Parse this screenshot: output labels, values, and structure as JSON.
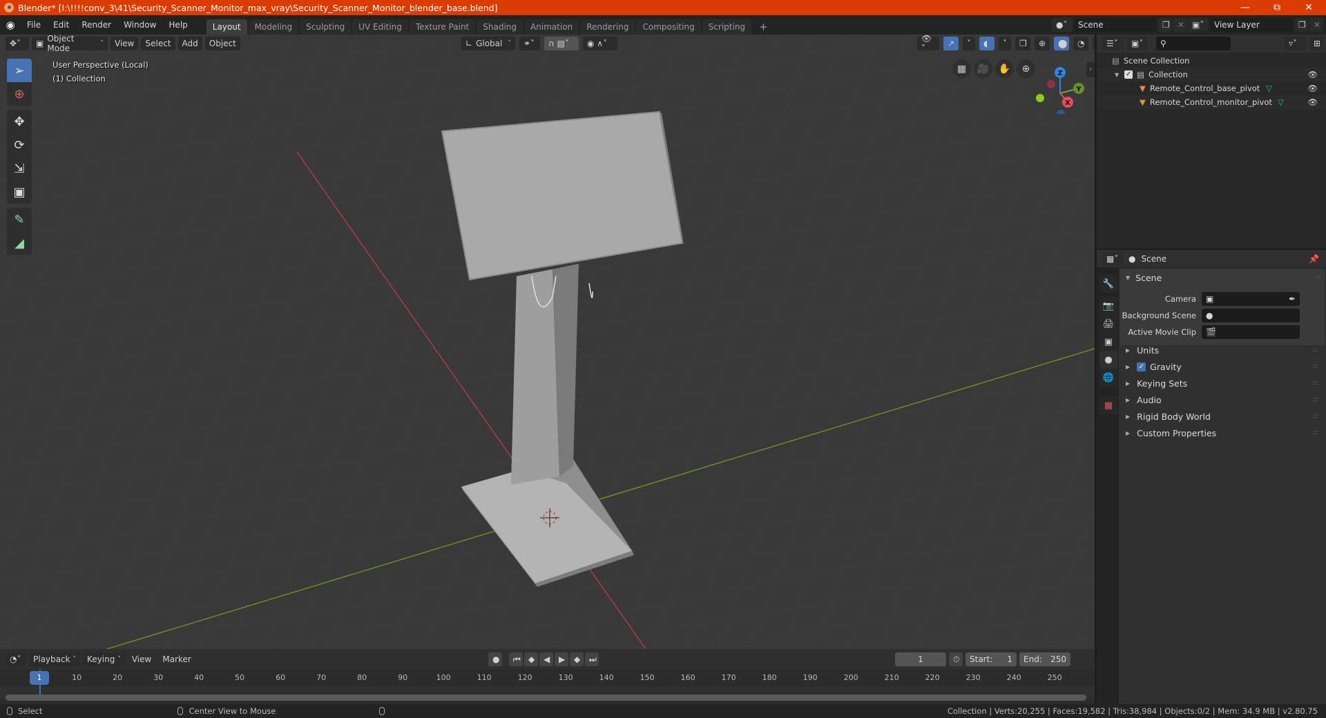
{
  "window": {
    "title": "Blender* [I:\\!!!!conv_3\\41\\Security_Scanner_Monitor_max_vray\\Security_Scanner_Monitor_blender_base.blend]",
    "controls": [
      "minimize-icon",
      "maximize-icon",
      "close-icon"
    ]
  },
  "menubar": {
    "items": [
      "File",
      "Edit",
      "Render",
      "Window",
      "Help"
    ],
    "workspace_tabs": [
      "Layout",
      "Modeling",
      "Sculpting",
      "UV Editing",
      "Texture Paint",
      "Shading",
      "Animation",
      "Rendering",
      "Compositing",
      "Scripting"
    ],
    "active_tab": "Layout",
    "add_tab": "+",
    "scene_field": "Scene",
    "view_layer_field": "View Layer"
  },
  "viewport": {
    "mode": "Object Mode",
    "menus": [
      "View",
      "Select",
      "Add",
      "Object"
    ],
    "transform_orientation": "Global",
    "overlay_text": [
      "User Perspective (Local)",
      "(1) Collection"
    ],
    "tools": [
      "select-box-icon",
      "cursor-icon",
      "move-icon",
      "rotate-icon",
      "scale-icon",
      "transform-icon",
      "annotate-icon",
      "measure-icon"
    ],
    "nav_buttons": [
      "grid-view-icon",
      "camera-view-icon",
      "pan-hand-icon",
      "zoom-icon"
    ],
    "gizmo_axes": [
      "Z",
      "Y",
      "X"
    ],
    "colors": {
      "x_axis": "#c8394c",
      "y_axis": "#7aa22f",
      "z_axis": "#2f86e3",
      "background": "#393939",
      "model": "#a8a8a8"
    }
  },
  "outliner": {
    "root": "Scene Collection",
    "collection": "Collection",
    "objects": [
      "Remote_Control_base_pivot",
      "Remote_Control_monitor_pivot"
    ]
  },
  "properties": {
    "context": "Scene",
    "section": "Scene",
    "fields": [
      {
        "label": "Camera",
        "value": ""
      },
      {
        "label": "Background Scene",
        "value": ""
      },
      {
        "label": "Active Movie Clip",
        "value": ""
      }
    ],
    "panels": [
      "Units",
      "Gravity",
      "Keying Sets",
      "Audio",
      "Rigid Body World",
      "Custom Properties"
    ],
    "gravity_checked": true
  },
  "timeline": {
    "menus": [
      "Playback",
      "Keying",
      "View",
      "Marker"
    ],
    "current_frame": "1",
    "start_label": "Start:",
    "start": "1",
    "end_label": "End:",
    "end": "250",
    "ruler_ticks": [
      "1",
      "10",
      "20",
      "30",
      "40",
      "50",
      "60",
      "70",
      "80",
      "90",
      "100",
      "110",
      "120",
      "130",
      "140",
      "150",
      "160",
      "170",
      "180",
      "190",
      "200",
      "210",
      "220",
      "230",
      "240",
      "250"
    ]
  },
  "statusbar": {
    "left_action": "Select",
    "middle_action": "Center View to Mouse",
    "stats": "Collection | Verts:20,255 | Faces:19,582 | Tris:38,984 | Objects:0/2 | Mem: 34.9 MB | v2.80.75"
  }
}
